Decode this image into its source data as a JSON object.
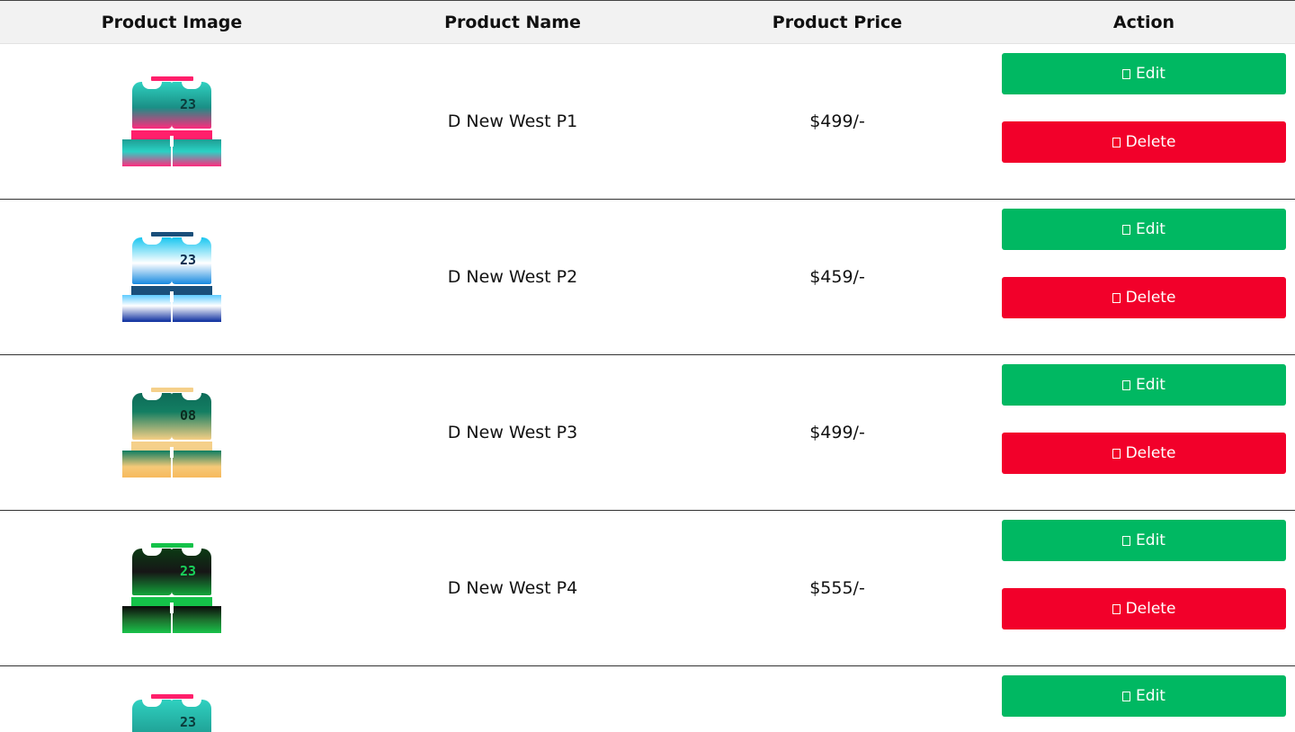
{
  "table": {
    "headers": [
      "Product Image",
      "Product Name",
      "Product Price",
      "Action"
    ],
    "rows": [
      {
        "name": "D New West P1",
        "price": "$499/-",
        "image": "jersey-pink-teal",
        "number": "23"
      },
      {
        "name": "D New West P2",
        "price": "$459/-",
        "image": "jersey-blue-white",
        "number": "23"
      },
      {
        "name": "D New West P3",
        "price": "$499/-",
        "image": "jersey-green-sand",
        "number": "08"
      },
      {
        "name": "D New West P4",
        "price": "$555/-",
        "image": "jersey-black-green",
        "number": "23"
      },
      {
        "name": "",
        "price": "",
        "image": "jersey-pink-teal",
        "number": "23"
      }
    ]
  },
  "actions": {
    "edit_label": "Edit",
    "delete_label": "Delete",
    "edit_icon": "edit-icon",
    "delete_icon": "trash-icon"
  },
  "colors": {
    "edit": "#00b862",
    "delete": "#f2002a",
    "header_bg": "#f2f2f2"
  }
}
